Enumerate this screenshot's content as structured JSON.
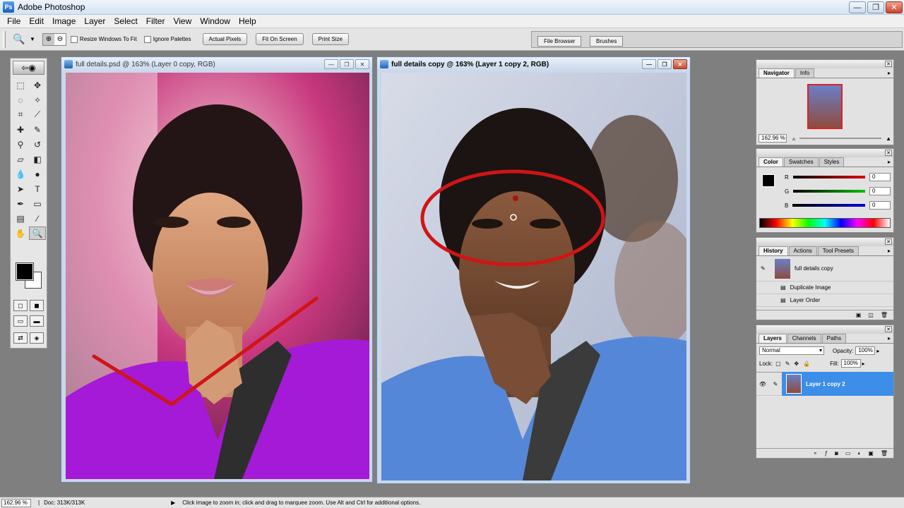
{
  "app": {
    "title": "Adobe Photoshop",
    "icon": "photoshop-icon"
  },
  "menu": [
    "File",
    "Edit",
    "Image",
    "Layer",
    "Select",
    "Filter",
    "View",
    "Window",
    "Help"
  ],
  "options": {
    "resize_windows": "Resize Windows To Fit",
    "ignore_palettes": "Ignore Palettes",
    "actual_pixels": "Actual Pixels",
    "fit_on_screen": "Fit On Screen",
    "print_size": "Print Size"
  },
  "well_tabs": [
    "File Browser",
    "Brushes"
  ],
  "documents": [
    {
      "title": "full details.psd @ 163% (Layer 0 copy, RGB)"
    },
    {
      "title": "full details copy @ 163% (Layer 1 copy 2, RGB)"
    }
  ],
  "navigator": {
    "tabs": [
      "Navigator",
      "Info"
    ],
    "zoom": "162.96 %"
  },
  "color": {
    "tabs": [
      "Color",
      "Swatches",
      "Styles"
    ],
    "channels": [
      {
        "label": "R",
        "value": "0",
        "color": "#e00000"
      },
      {
        "label": "G",
        "value": "0",
        "color": "#00c000"
      },
      {
        "label": "B",
        "value": "0",
        "color": "#0000e0"
      }
    ]
  },
  "history": {
    "tabs": [
      "History",
      "Actions",
      "Tool Presets"
    ],
    "snapshot": "full details copy",
    "items": [
      "Duplicate Image",
      "Layer Order"
    ]
  },
  "layers": {
    "tabs": [
      "Layers",
      "Channels",
      "Paths"
    ],
    "blend_mode": "Normal",
    "opacity_label": "Opacity:",
    "opacity": "100%",
    "lock_label": "Lock:",
    "fill_label": "Fill:",
    "fill": "100%",
    "layer_name": "Layer 1 copy 2"
  },
  "status": {
    "zoom": "162.96 %",
    "doc": "Doc: 313K/313K",
    "hint": "Click image to zoom in; click and drag to marquee zoom.  Use Alt and Ctrl for additional options."
  },
  "colors": {
    "selected_layer": "#3d8ee8",
    "annotation_red": "#d01515"
  }
}
